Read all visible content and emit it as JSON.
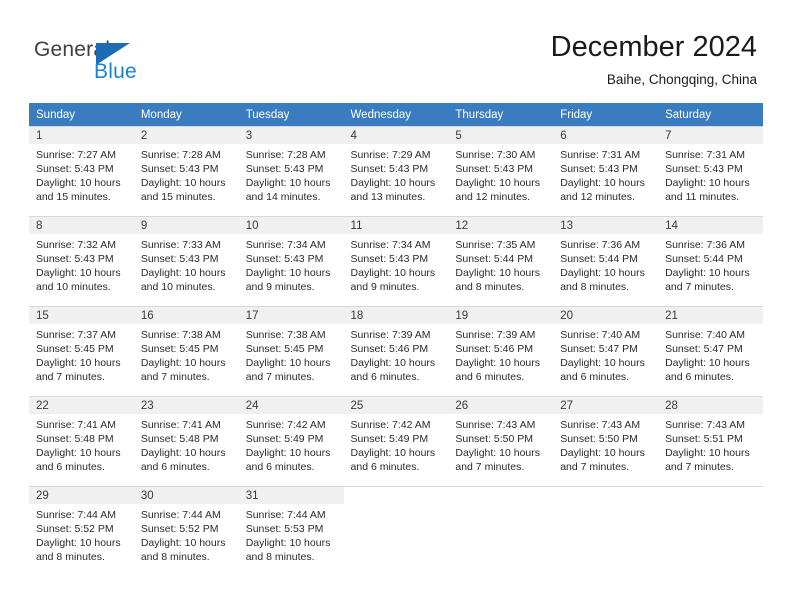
{
  "brand": {
    "name_part1": "General",
    "name_part2": "Blue",
    "color_dark": "#3f3f3f",
    "color_blue": "#1a83d6",
    "triangle_color": "#1a6cb5"
  },
  "header": {
    "month_title": "December 2024",
    "location": "Baihe, Chongqing, China"
  },
  "theme": {
    "header_row_bg": "#3a7cc0",
    "header_row_text": "#ffffff",
    "daynum_bg": "#f0f0f0",
    "cell_bg": "#ffffff",
    "separator": "#d8d8d8"
  },
  "weekday_headers": [
    "Sunday",
    "Monday",
    "Tuesday",
    "Wednesday",
    "Thursday",
    "Friday",
    "Saturday"
  ],
  "weeks": [
    [
      {
        "day": "1",
        "sunrise": "Sunrise: 7:27 AM",
        "sunset": "Sunset: 5:43 PM",
        "daylight_line1": "Daylight: 10 hours",
        "daylight_line2": "and 15 minutes."
      },
      {
        "day": "2",
        "sunrise": "Sunrise: 7:28 AM",
        "sunset": "Sunset: 5:43 PM",
        "daylight_line1": "Daylight: 10 hours",
        "daylight_line2": "and 15 minutes."
      },
      {
        "day": "3",
        "sunrise": "Sunrise: 7:28 AM",
        "sunset": "Sunset: 5:43 PM",
        "daylight_line1": "Daylight: 10 hours",
        "daylight_line2": "and 14 minutes."
      },
      {
        "day": "4",
        "sunrise": "Sunrise: 7:29 AM",
        "sunset": "Sunset: 5:43 PM",
        "daylight_line1": "Daylight: 10 hours",
        "daylight_line2": "and 13 minutes."
      },
      {
        "day": "5",
        "sunrise": "Sunrise: 7:30 AM",
        "sunset": "Sunset: 5:43 PM",
        "daylight_line1": "Daylight: 10 hours",
        "daylight_line2": "and 12 minutes."
      },
      {
        "day": "6",
        "sunrise": "Sunrise: 7:31 AM",
        "sunset": "Sunset: 5:43 PM",
        "daylight_line1": "Daylight: 10 hours",
        "daylight_line2": "and 12 minutes."
      },
      {
        "day": "7",
        "sunrise": "Sunrise: 7:31 AM",
        "sunset": "Sunset: 5:43 PM",
        "daylight_line1": "Daylight: 10 hours",
        "daylight_line2": "and 11 minutes."
      }
    ],
    [
      {
        "day": "8",
        "sunrise": "Sunrise: 7:32 AM",
        "sunset": "Sunset: 5:43 PM",
        "daylight_line1": "Daylight: 10 hours",
        "daylight_line2": "and 10 minutes."
      },
      {
        "day": "9",
        "sunrise": "Sunrise: 7:33 AM",
        "sunset": "Sunset: 5:43 PM",
        "daylight_line1": "Daylight: 10 hours",
        "daylight_line2": "and 10 minutes."
      },
      {
        "day": "10",
        "sunrise": "Sunrise: 7:34 AM",
        "sunset": "Sunset: 5:43 PM",
        "daylight_line1": "Daylight: 10 hours",
        "daylight_line2": "and 9 minutes."
      },
      {
        "day": "11",
        "sunrise": "Sunrise: 7:34 AM",
        "sunset": "Sunset: 5:43 PM",
        "daylight_line1": "Daylight: 10 hours",
        "daylight_line2": "and 9 minutes."
      },
      {
        "day": "12",
        "sunrise": "Sunrise: 7:35 AM",
        "sunset": "Sunset: 5:44 PM",
        "daylight_line1": "Daylight: 10 hours",
        "daylight_line2": "and 8 minutes."
      },
      {
        "day": "13",
        "sunrise": "Sunrise: 7:36 AM",
        "sunset": "Sunset: 5:44 PM",
        "daylight_line1": "Daylight: 10 hours",
        "daylight_line2": "and 8 minutes."
      },
      {
        "day": "14",
        "sunrise": "Sunrise: 7:36 AM",
        "sunset": "Sunset: 5:44 PM",
        "daylight_line1": "Daylight: 10 hours",
        "daylight_line2": "and 7 minutes."
      }
    ],
    [
      {
        "day": "15",
        "sunrise": "Sunrise: 7:37 AM",
        "sunset": "Sunset: 5:45 PM",
        "daylight_line1": "Daylight: 10 hours",
        "daylight_line2": "and 7 minutes."
      },
      {
        "day": "16",
        "sunrise": "Sunrise: 7:38 AM",
        "sunset": "Sunset: 5:45 PM",
        "daylight_line1": "Daylight: 10 hours",
        "daylight_line2": "and 7 minutes."
      },
      {
        "day": "17",
        "sunrise": "Sunrise: 7:38 AM",
        "sunset": "Sunset: 5:45 PM",
        "daylight_line1": "Daylight: 10 hours",
        "daylight_line2": "and 7 minutes."
      },
      {
        "day": "18",
        "sunrise": "Sunrise: 7:39 AM",
        "sunset": "Sunset: 5:46 PM",
        "daylight_line1": "Daylight: 10 hours",
        "daylight_line2": "and 6 minutes."
      },
      {
        "day": "19",
        "sunrise": "Sunrise: 7:39 AM",
        "sunset": "Sunset: 5:46 PM",
        "daylight_line1": "Daylight: 10 hours",
        "daylight_line2": "and 6 minutes."
      },
      {
        "day": "20",
        "sunrise": "Sunrise: 7:40 AM",
        "sunset": "Sunset: 5:47 PM",
        "daylight_line1": "Daylight: 10 hours",
        "daylight_line2": "and 6 minutes."
      },
      {
        "day": "21",
        "sunrise": "Sunrise: 7:40 AM",
        "sunset": "Sunset: 5:47 PM",
        "daylight_line1": "Daylight: 10 hours",
        "daylight_line2": "and 6 minutes."
      }
    ],
    [
      {
        "day": "22",
        "sunrise": "Sunrise: 7:41 AM",
        "sunset": "Sunset: 5:48 PM",
        "daylight_line1": "Daylight: 10 hours",
        "daylight_line2": "and 6 minutes."
      },
      {
        "day": "23",
        "sunrise": "Sunrise: 7:41 AM",
        "sunset": "Sunset: 5:48 PM",
        "daylight_line1": "Daylight: 10 hours",
        "daylight_line2": "and 6 minutes."
      },
      {
        "day": "24",
        "sunrise": "Sunrise: 7:42 AM",
        "sunset": "Sunset: 5:49 PM",
        "daylight_line1": "Daylight: 10 hours",
        "daylight_line2": "and 6 minutes."
      },
      {
        "day": "25",
        "sunrise": "Sunrise: 7:42 AM",
        "sunset": "Sunset: 5:49 PM",
        "daylight_line1": "Daylight: 10 hours",
        "daylight_line2": "and 6 minutes."
      },
      {
        "day": "26",
        "sunrise": "Sunrise: 7:43 AM",
        "sunset": "Sunset: 5:50 PM",
        "daylight_line1": "Daylight: 10 hours",
        "daylight_line2": "and 7 minutes."
      },
      {
        "day": "27",
        "sunrise": "Sunrise: 7:43 AM",
        "sunset": "Sunset: 5:50 PM",
        "daylight_line1": "Daylight: 10 hours",
        "daylight_line2": "and 7 minutes."
      },
      {
        "day": "28",
        "sunrise": "Sunrise: 7:43 AM",
        "sunset": "Sunset: 5:51 PM",
        "daylight_line1": "Daylight: 10 hours",
        "daylight_line2": "and 7 minutes."
      }
    ],
    [
      {
        "day": "29",
        "sunrise": "Sunrise: 7:44 AM",
        "sunset": "Sunset: 5:52 PM",
        "daylight_line1": "Daylight: 10 hours",
        "daylight_line2": "and 8 minutes."
      },
      {
        "day": "30",
        "sunrise": "Sunrise: 7:44 AM",
        "sunset": "Sunset: 5:52 PM",
        "daylight_line1": "Daylight: 10 hours",
        "daylight_line2": "and 8 minutes."
      },
      {
        "day": "31",
        "sunrise": "Sunrise: 7:44 AM",
        "sunset": "Sunset: 5:53 PM",
        "daylight_line1": "Daylight: 10 hours",
        "daylight_line2": "and 8 minutes."
      },
      {
        "day": "",
        "sunrise": "",
        "sunset": "",
        "daylight_line1": "",
        "daylight_line2": ""
      },
      {
        "day": "",
        "sunrise": "",
        "sunset": "",
        "daylight_line1": "",
        "daylight_line2": ""
      },
      {
        "day": "",
        "sunrise": "",
        "sunset": "",
        "daylight_line1": "",
        "daylight_line2": ""
      },
      {
        "day": "",
        "sunrise": "",
        "sunset": "",
        "daylight_line1": "",
        "daylight_line2": ""
      }
    ]
  ]
}
